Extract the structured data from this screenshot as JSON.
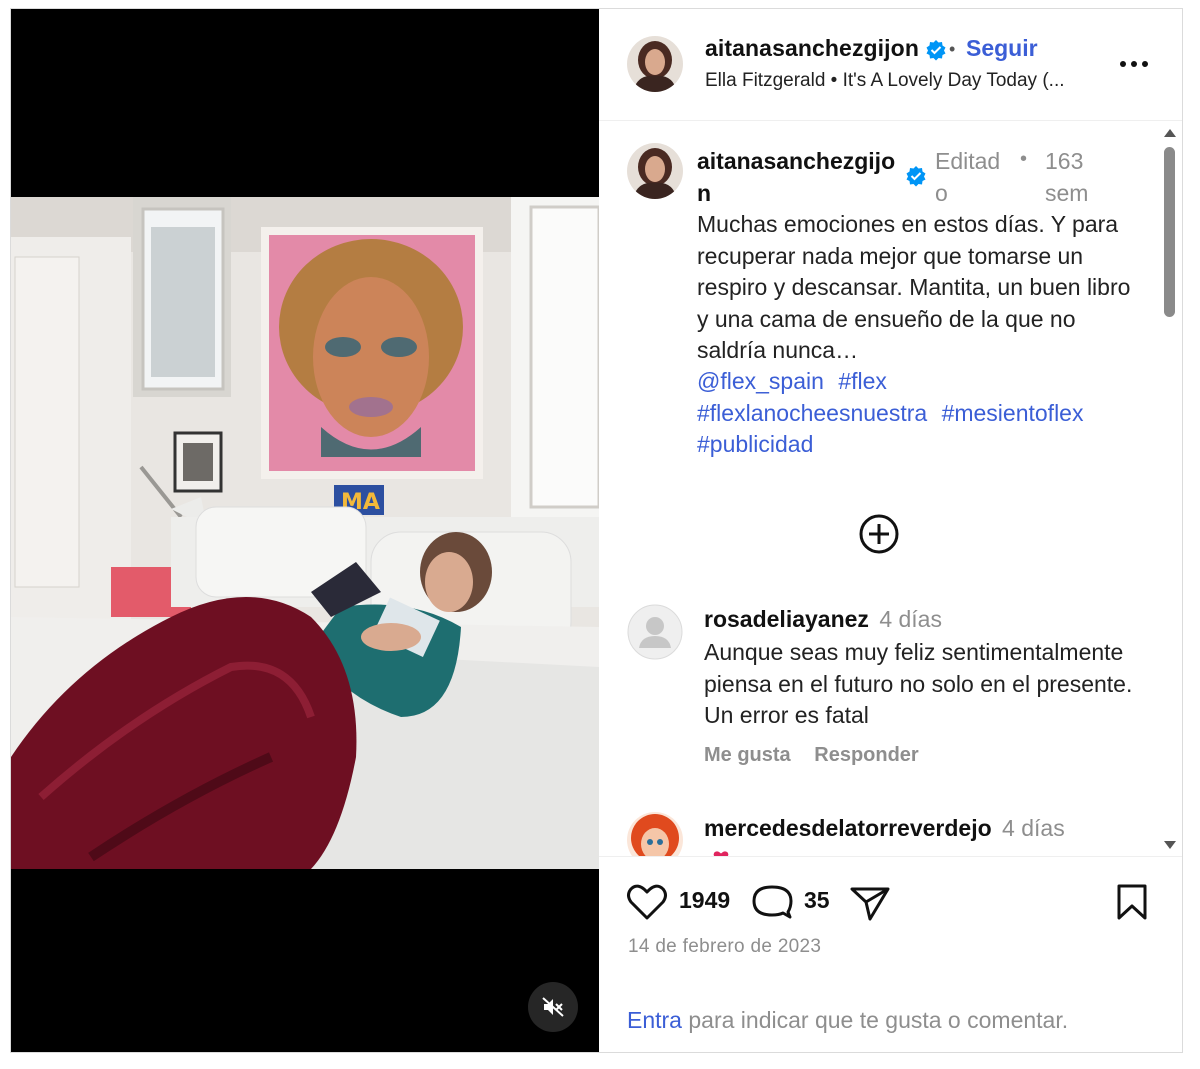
{
  "header": {
    "username": "aitanasanchezgijon",
    "separator": "•",
    "follow_label": "Seguir",
    "audio_artist": "Ella Fitzgerald",
    "audio_separator": "•",
    "audio_title": "It's A Lovely Day Today (..."
  },
  "caption": {
    "username": "aitanasanchezgijon",
    "edited": "Editado",
    "separator": "•",
    "time": "163 sem",
    "text": "Muchas emociones en estos días.  Y para recuperar nada mejor que tomarse un respiro y descansar. Mantita, un buen libro y una cama de ensueño de la que no saldría nunca…",
    "tags": [
      "@flex_spain",
      "#flex",
      "#flexlanocheesnuestra",
      "#mesientoflex",
      "#publicidad"
    ]
  },
  "comments": [
    {
      "username": "rosadeliayanez",
      "time": "4 días",
      "text": "Aunque seas muy feliz sentimentalmente piensa en el futuro no solo en el presente. Un error es fatal",
      "like_label": "Me gusta",
      "reply_label": "Responder"
    },
    {
      "username": "mercedesdelatorreverdejo",
      "time": "4 días"
    }
  ],
  "actions": {
    "likes": "1949",
    "comments": "35",
    "date": "14 de febrero de 2023",
    "login_link": "Entra",
    "login_rest": " para indicar que te gusta o comentar."
  },
  "icons": {
    "verified": "verified-badge-icon",
    "more": "more-options-icon",
    "mute": "muted-speaker-icon",
    "load_more": "plus-circle-icon",
    "like": "heart-icon",
    "comment": "comment-bubble-icon",
    "share": "paper-plane-icon",
    "save": "bookmark-icon"
  },
  "colors": {
    "link_blue": "#3b5ed6",
    "verified_blue": "#0095f6",
    "muted_gray": "#8e8e8e",
    "heart_red": "#e0245e"
  }
}
